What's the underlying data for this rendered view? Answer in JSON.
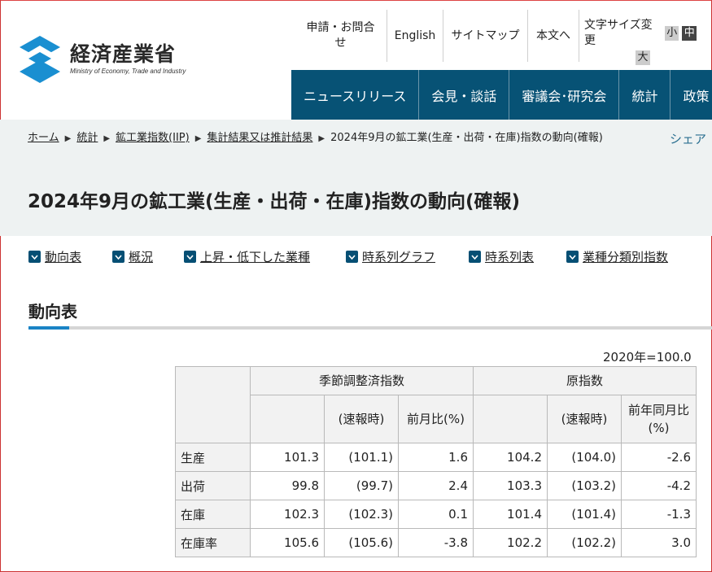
{
  "header": {
    "logo": {
      "jp": "経済産業省",
      "en": "Ministry of Economy, Trade and Industry",
      "icon": "meti-logo-icon"
    },
    "utility": {
      "contact": "申請・お問合せ",
      "english": "English",
      "sitemap": "サイトマップ",
      "main_text": "本文へ",
      "font_size": {
        "label": "文字サイズ変更",
        "small": "小",
        "medium": "中",
        "large": "大",
        "selected": "中"
      }
    },
    "gnav": [
      "ニュースリリース",
      "会見・談話",
      "審議会･研究会",
      "統計",
      "政策"
    ]
  },
  "breadcrumb": {
    "items": [
      "ホーム",
      "統計",
      "鉱工業指数(IIP)",
      "集計結果又は推計結果"
    ],
    "current": "2024年9月の鉱工業(生産・出荷・在庫)指数の動向(確報)"
  },
  "share_label": "シェア",
  "page_title": "2024年9月の鉱工業(生産・出荷・在庫)指数の動向(確報)",
  "anchors": [
    "動向表",
    "概況",
    "上昇・低下した業種",
    "時系列グラフ",
    "時系列表",
    "業種分類別指数"
  ],
  "section": {
    "title": "動向表",
    "unit": "2020年=100.0"
  },
  "table": {
    "group_seasonal": "季節調整済指数",
    "group_original": "原指数",
    "col_prelim": "(速報時)",
    "col_mom": "前月比(%)",
    "col_yoy": "前年同月比(%)",
    "rows": [
      {
        "label": "生産",
        "sa": "101.3",
        "sa_prelim": "(101.1)",
        "mom": "1.6",
        "orig": "104.2",
        "orig_prelim": "(104.0)",
        "yoy": "-2.6"
      },
      {
        "label": "出荷",
        "sa": "99.8",
        "sa_prelim": "(99.7)",
        "mom": "2.4",
        "orig": "103.3",
        "orig_prelim": "(103.2)",
        "yoy": "-4.2"
      },
      {
        "label": "在庫",
        "sa": "102.3",
        "sa_prelim": "(102.3)",
        "mom": "0.1",
        "orig": "101.4",
        "orig_prelim": "(101.4)",
        "yoy": "-1.3"
      },
      {
        "label": "在庫率",
        "sa": "105.6",
        "sa_prelim": "(105.6)",
        "mom": "-3.8",
        "orig": "102.2",
        "orig_prelim": "(102.2)",
        "yoy": "3.0"
      }
    ]
  },
  "colors": {
    "nav_bg": "#075275",
    "accent": "#1a83c5",
    "band_bg": "#eef2f2"
  }
}
